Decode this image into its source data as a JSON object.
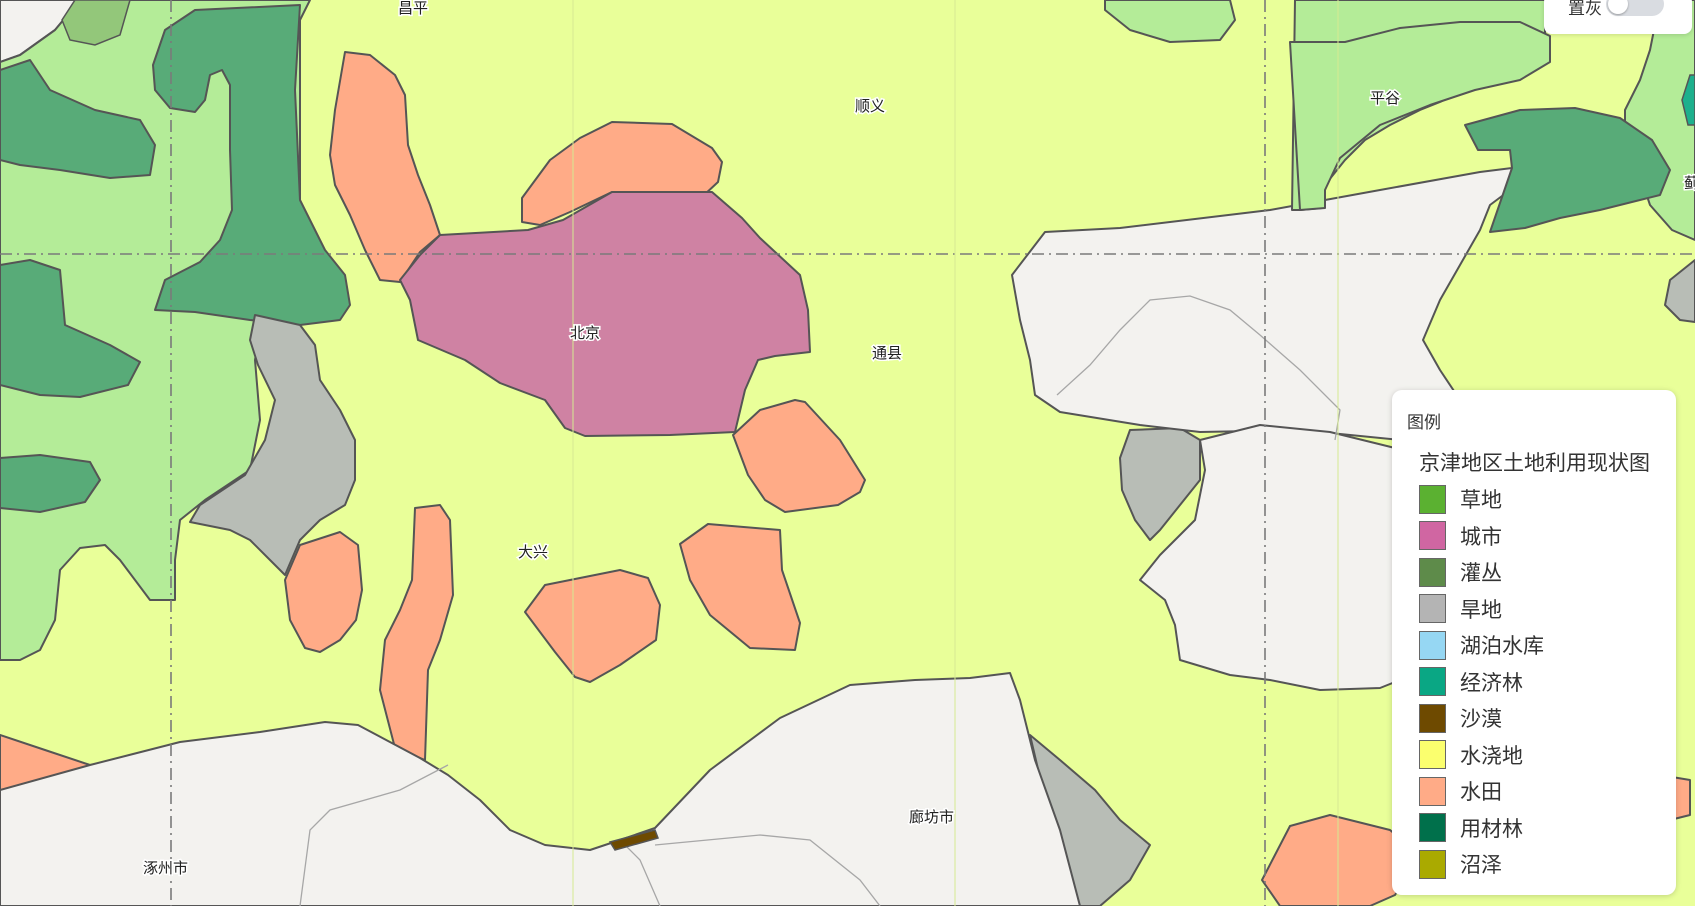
{
  "map": {
    "places": [
      {
        "id": "changping",
        "label": "昌平"
      },
      {
        "id": "shunyi",
        "label": "顺义"
      },
      {
        "id": "pinggu",
        "label": "平谷"
      },
      {
        "id": "ji",
        "label": "蓟"
      },
      {
        "id": "beijing",
        "label": "北京"
      },
      {
        "id": "tongxian",
        "label": "通县"
      },
      {
        "id": "daxing",
        "label": "大兴"
      },
      {
        "id": "langfang",
        "label": "廊坊市"
      },
      {
        "id": "zhuozhou",
        "label": "涿州市"
      }
    ]
  },
  "toggle": {
    "label": "置灰",
    "checked": false
  },
  "legend": {
    "title": "图例",
    "layer_name": "京津地区土地利用现状图",
    "items": [
      {
        "label": "草地",
        "color": "#5bb131"
      },
      {
        "label": "城市",
        "color": "#d066a2"
      },
      {
        "label": "灌丛",
        "color": "#5e8b4a"
      },
      {
        "label": "旱地",
        "color": "#b4b4b4"
      },
      {
        "label": "湖泊水库",
        "color": "#96d7f3"
      },
      {
        "label": "经济林",
        "color": "#0aa784"
      },
      {
        "label": "沙漠",
        "color": "#6e4a00"
      },
      {
        "label": "水浇地",
        "color": "#fbff6e"
      },
      {
        "label": "水田",
        "color": "#ffab87"
      },
      {
        "label": "用材林",
        "color": "#00704b"
      },
      {
        "label": "沼泽",
        "color": "#aaaa00"
      }
    ]
  },
  "map_colors": {
    "irrigated": "#e9ff99",
    "grassland_light": "#b4ec98",
    "timber_forest": "#58ab78",
    "paddy": "#ffab87",
    "city": "#cf82a3",
    "dryland": "#b8bdb6",
    "outside": "#f3f2ef",
    "desert": "#6e4a00",
    "economic_forest": "#1db08d"
  }
}
